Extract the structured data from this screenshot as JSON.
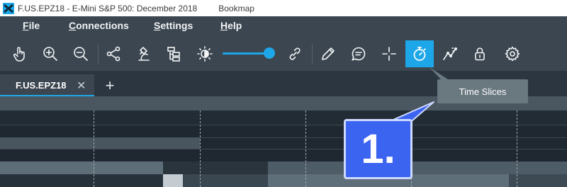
{
  "window": {
    "title": "F.US.EPZ18 - E-Mini S&P 500: December 2018",
    "app_name": "Bookmap"
  },
  "menu": [
    {
      "label": "File",
      "mnemonic": "F",
      "rest": "ile"
    },
    {
      "label": "Connections",
      "mnemonic": "C",
      "rest": "onnections"
    },
    {
      "label": "Settings",
      "mnemonic": "S",
      "rest": "ettings"
    },
    {
      "label": "Help",
      "mnemonic": "H",
      "rest": "elp"
    }
  ],
  "toolbar": {
    "icons": [
      "hand-icon",
      "zoom-in-icon",
      "zoom-out-icon",
      "share-icon",
      "microscope-icon",
      "hierarchy-icon",
      "brightness-icon",
      "link-icon",
      "pencil-icon",
      "chat-icon",
      "crosshair-icon",
      "stopwatch-icon",
      "chart-line-icon",
      "lock-icon",
      "gear-icon"
    ],
    "active_icon": "stopwatch-icon",
    "brightness_level": 0.85,
    "accent_color": "#1ea7e8"
  },
  "tabs": [
    {
      "label": "F.US.EPZ18",
      "close": "✕"
    }
  ],
  "add_tab_label": "+",
  "tooltip": {
    "text": "Time Slices"
  },
  "callout": {
    "text": "1."
  }
}
